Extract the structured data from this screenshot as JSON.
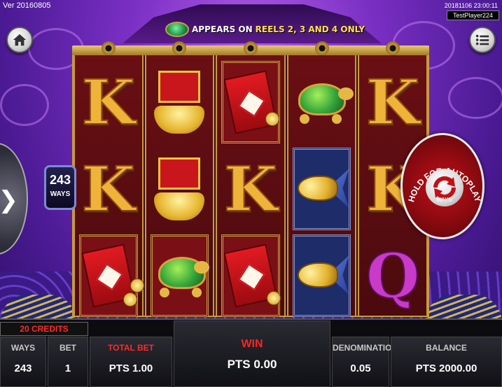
{
  "header": {
    "version": "Ver 20160805",
    "datetime": "20181106 23:00:11",
    "player": "TestPlayer224"
  },
  "banner": {
    "gem_label": "WILD",
    "part1": "APPEARS ON",
    "part2": "REELS 2, 3 AND 4 ONLY"
  },
  "reels": [
    [
      "K",
      "K",
      "red-envelope"
    ],
    [
      "gold-ingot",
      "gold-ingot",
      "turtle"
    ],
    [
      "red-envelope",
      "K",
      "red-envelope"
    ],
    [
      "turtle",
      "golden-fish",
      "golden-fish"
    ],
    [
      "K",
      "K",
      "Q"
    ]
  ],
  "ways_badge": {
    "number": "243",
    "label": "WAYS"
  },
  "spin_button": {
    "label": "HOLD FOR AUTOPLAY",
    "sub_label": "WAYS"
  },
  "footer": {
    "credits": "20 CREDITS",
    "ways_label": "WAYS",
    "ways_value": "243",
    "bet_label": "BET",
    "bet_value": "1",
    "total_bet_label": "TOTAL BET",
    "total_bet_value": "PTS 1.00",
    "win_label": "WIN",
    "win_value": "PTS 0.00",
    "denomination_label": "DENOMINATION",
    "denomination_value": "0.05",
    "balance_label": "BALANCE",
    "balance_value": "PTS 2000.00"
  },
  "colors": {
    "accent_red": "#ff2a2a",
    "gold": "#f0b33a",
    "background_purple": "#7a2fc4"
  },
  "icons": [
    "home-icon",
    "menu-icon",
    "chevron-right-icon",
    "refresh-icon"
  ]
}
